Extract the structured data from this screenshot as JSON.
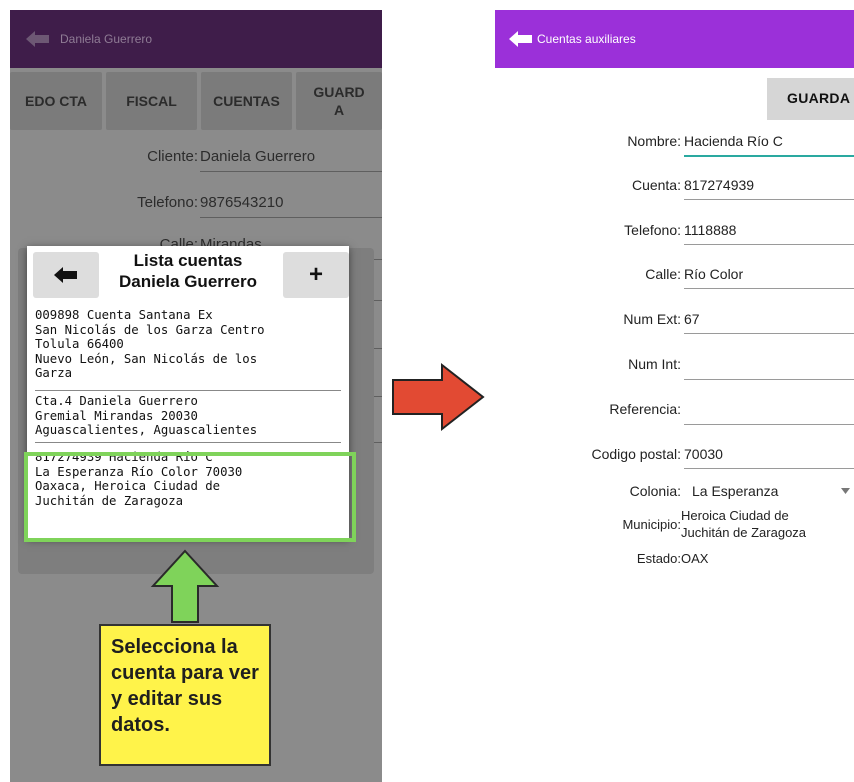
{
  "left": {
    "header": {
      "title": "Daniela Guerrero",
      "back_icon": "arrow-left-icon"
    },
    "tabs": [
      "EDO CTA",
      "FISCAL",
      "CUENTAS",
      "GUARD\nA"
    ],
    "fields": [
      {
        "label": "Cliente:",
        "value": "Daniela Guerrero"
      },
      {
        "label": "Telefono:",
        "value": "9876543210"
      },
      {
        "label": "Calle:",
        "value": "Mirandas"
      }
    ],
    "dialog": {
      "title_line1": "Lista cuentas",
      "title_line2": "Daniela Guerrero",
      "back_button": "🡄",
      "add_button": "+",
      "items": [
        "009898 Cuenta Santana Ex\nSan Nicolás de los Garza Centro\nTolula 66400\nNuevo León, San Nicolás de los\nGarza",
        "Cta.4 Daniela Guerrero\nGremial Mirandas 20030\nAguascalientes, Aguascalientes",
        "817274939 Hacienda Río C\nLa Esperanza Río Color 70030\nOaxaca, Heroica Ciudad de\nJuchitán de Zaragoza"
      ]
    },
    "callout": "Selecciona la cuenta para ver y editar sus datos."
  },
  "right": {
    "header": {
      "title": "Cuentas auxiliares",
      "back_icon": "arrow-left-icon"
    },
    "save_label": "GUARDA",
    "fields": [
      {
        "label": "Nombre:",
        "value": "Hacienda Río C"
      },
      {
        "label": "Cuenta:",
        "value": "817274939"
      },
      {
        "label": "Telefono:",
        "value": "1118888"
      },
      {
        "label": "Calle:",
        "value": "Río Color"
      },
      {
        "label": "Num Ext:",
        "value": "67"
      },
      {
        "label": "Num Int:",
        "value": ""
      },
      {
        "label": "Referencia:",
        "value": ""
      },
      {
        "label": "Codigo postal:",
        "value": "70030"
      }
    ],
    "colonia": {
      "label": "Colonia:",
      "value": "La Esperanza"
    },
    "municipio": {
      "label": "Municipio:",
      "value": "Heroica Ciudad de\nJuchitán de Zaragoza"
    },
    "estado": {
      "label": "Estado:",
      "value": "OAX"
    }
  },
  "colors": {
    "left_appbar": "#3f1d4a",
    "right_appbar": "#9b30d9",
    "overlay": "#8b8b8b",
    "highlight_green": "#7fd35a",
    "arrow_red": "#e24a33",
    "callout_yellow": "#fff34a"
  }
}
